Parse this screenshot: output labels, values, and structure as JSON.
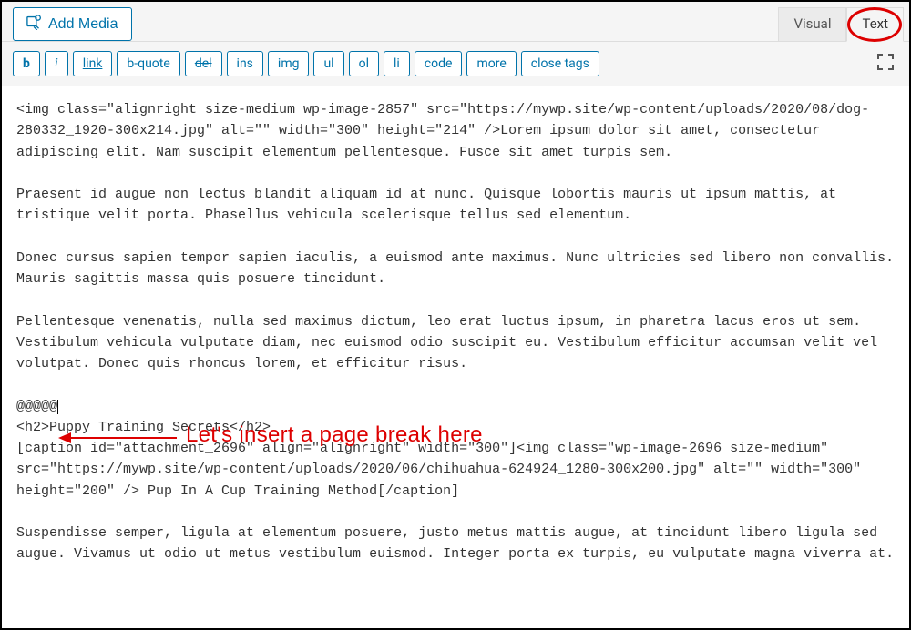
{
  "toolbar": {
    "add_media_label": "Add Media"
  },
  "tabs": {
    "visual": "Visual",
    "text": "Text"
  },
  "qt": {
    "b": "b",
    "i": "i",
    "link": "link",
    "bquote": "b-quote",
    "del": "del",
    "ins": "ins",
    "img": "img",
    "ul": "ul",
    "ol": "ol",
    "li": "li",
    "code": "code",
    "more": "more",
    "close": "close tags"
  },
  "editor": {
    "p1": "<img class=\"alignright size-medium wp-image-2857\" src=\"https://mywp.site/wp-content/uploads/2020/08/dog-280332_1920-300x214.jpg\" alt=\"\" width=\"300\" height=\"214\" />Lorem ipsum dolor sit amet, consectetur adipiscing elit. Nam suscipit elementum pellentesque. Fusce sit amet turpis sem.",
    "p2": "Praesent id augue non lectus blandit aliquam id at nunc. Quisque lobortis mauris ut ipsum mattis, at tristique velit porta. Phasellus vehicula scelerisque tellus sed elementum.",
    "p3": "Donec cursus sapien tempor sapien iaculis, a euismod ante maximus. Nunc ultricies sed libero non convallis. Mauris sagittis massa quis posuere tincidunt.",
    "p4": "Pellentesque venenatis, nulla sed maximus dictum, leo erat luctus ipsum, in pharetra lacus eros ut sem. Vestibulum vehicula vulputate diam, nec euismod odio suscipit eu. Vestibulum efficitur accumsan velit vel volutpat. Donec quis rhoncus lorem, et efficitur risus.",
    "marker": "@@@@@",
    "p5a": "<h2>Puppy Training Secrets</h2>",
    "p5b": "[caption id=\"attachment_2696\" align=\"alignright\" width=\"300\"]<img class=\"wp-image-2696 size-medium\" src=\"https://mywp.site/wp-content/uploads/2020/06/chihuahua-624924_1280-300x200.jpg\" alt=\"\" width=\"300\" height=\"200\" /> Pup In A Cup Training Method[/caption]",
    "p6": "Suspendisse semper, ligula at elementum posuere, justo metus mattis augue, at tincidunt libero ligula sed augue. Vivamus ut odio ut metus vestibulum euismod. Integer porta ex turpis, eu vulputate magna viverra at."
  },
  "annotation": {
    "text": "Let's insert a page break here"
  }
}
